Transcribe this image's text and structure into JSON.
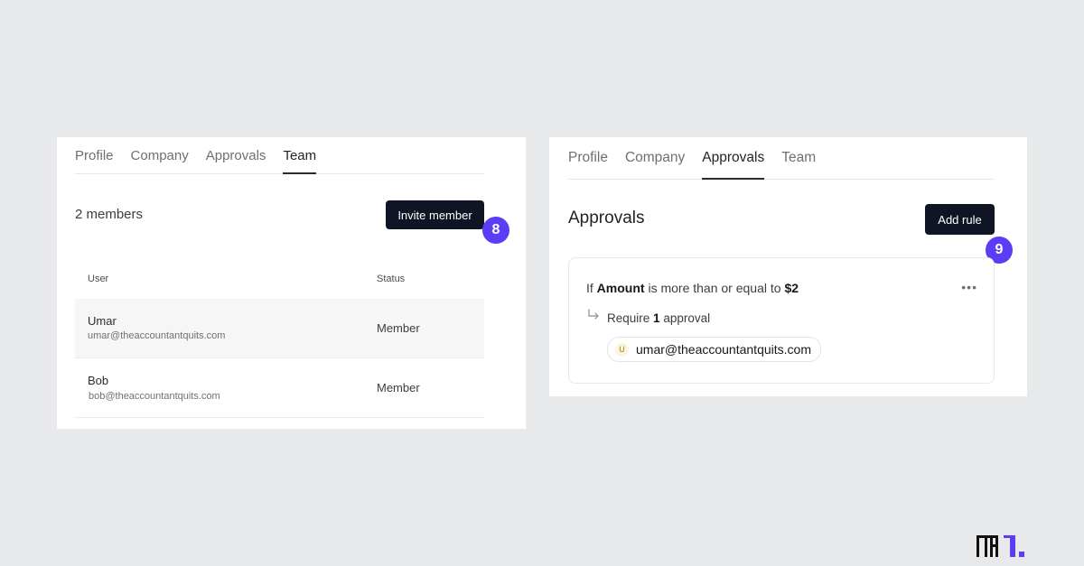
{
  "left_panel": {
    "tabs": [
      {
        "label": "Profile",
        "active": false
      },
      {
        "label": "Company",
        "active": false
      },
      {
        "label": "Approvals",
        "active": false
      },
      {
        "label": "Team",
        "active": true
      }
    ],
    "members_count": "2 members",
    "invite_button": "Invite member",
    "step_badge": "8",
    "table": {
      "headers": [
        "User",
        "Status"
      ],
      "rows": [
        {
          "name": "Umar",
          "email": "umar@theaccountantquits.com",
          "status": "Member"
        },
        {
          "name": "Bob",
          "email": "bob@theaccountantquits.com",
          "status": "Member"
        }
      ]
    }
  },
  "right_panel": {
    "tabs": [
      {
        "label": "Profile",
        "active": false
      },
      {
        "label": "Company",
        "active": false
      },
      {
        "label": "Approvals",
        "active": true
      },
      {
        "label": "Team",
        "active": false
      }
    ],
    "title": "Approvals",
    "add_rule_button": "Add rule",
    "step_badge": "9",
    "rule": {
      "prefix": "If",
      "field": "Amount",
      "operator": "is more than or equal to",
      "value": "$2",
      "require_prefix": "Require",
      "require_count": "1",
      "require_suffix": "approval",
      "approver_initial": "U",
      "approver_email": "umar@theaccountantquits.com"
    }
  },
  "colors": {
    "background": "#e8e9eb",
    "button_dark": "#0f1524",
    "badge_purple": "#5b3df5"
  },
  "icons": {
    "more": "more-horizontal-icon",
    "arrow": "corner-down-right-icon",
    "logo": "brand-logo"
  }
}
